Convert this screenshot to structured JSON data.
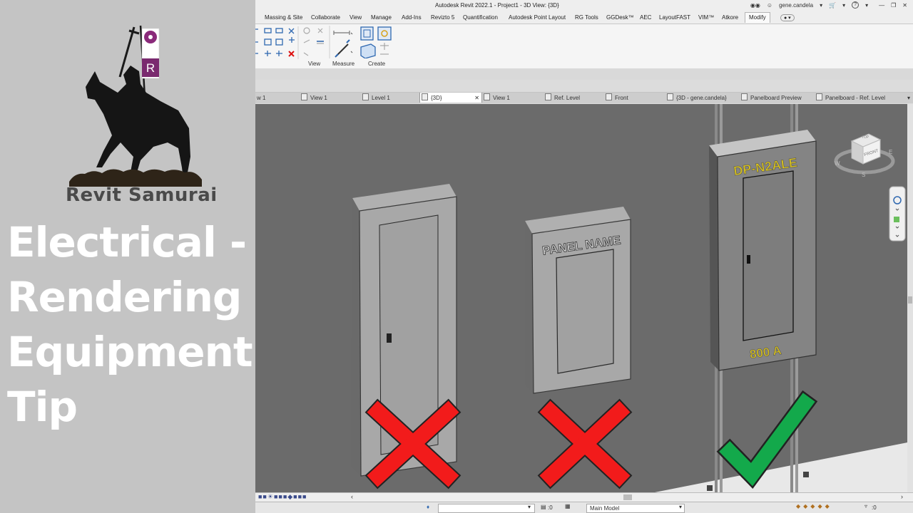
{
  "thumbnail": {
    "brand_name": "Revit Samurai",
    "banner_letter": "R",
    "headline": [
      "Electrical -",
      "Rendering",
      "Equipment",
      "Tip"
    ]
  },
  "app": {
    "title": "Autodesk Revit 2022.1 - Project1 - 3D View: {3D}",
    "username": "gene.candela",
    "help_symbol": "?",
    "menu": [
      "Massing & Site",
      "Collaborate",
      "View",
      "Manage",
      "Add-Ins",
      "Revizto 5",
      "Quantification",
      "Autodesk Point Layout",
      "RG Tools",
      "GGDesk™",
      "AEC",
      "LayoutFAST",
      "VIM™",
      "Atkore",
      "Modify"
    ],
    "active_menu": "Modify",
    "ribbon_groups": [
      "View",
      "Measure",
      "Create"
    ],
    "view_tabs": [
      {
        "label": "w 1"
      },
      {
        "label": "View 1"
      },
      {
        "label": "Level 1"
      },
      {
        "label": "{3D}",
        "active": true
      },
      {
        "label": "View 1"
      },
      {
        "label": "Ref. Level"
      },
      {
        "label": "Front"
      },
      {
        "label": "{3D - gene.candela}"
      },
      {
        "label": "Panelboard Preview"
      },
      {
        "label": "Panelboard - Ref. Level"
      }
    ],
    "viewcube": {
      "face": "FRONT",
      "top_label": "TOP",
      "compass": [
        "W",
        "S",
        "E"
      ]
    },
    "scene": {
      "panel_name_label": "PANEL NAME",
      "panel_tag": "DP-N2ALE",
      "panel_rating": "800 A"
    },
    "status": {
      "coord": ":0",
      "model": "Main Model",
      "filter_count": ":0"
    },
    "colors": {
      "reject_mark": "#f21b1b",
      "accept_mark": "#13a94b",
      "tag_text": "#d8c21e"
    }
  }
}
